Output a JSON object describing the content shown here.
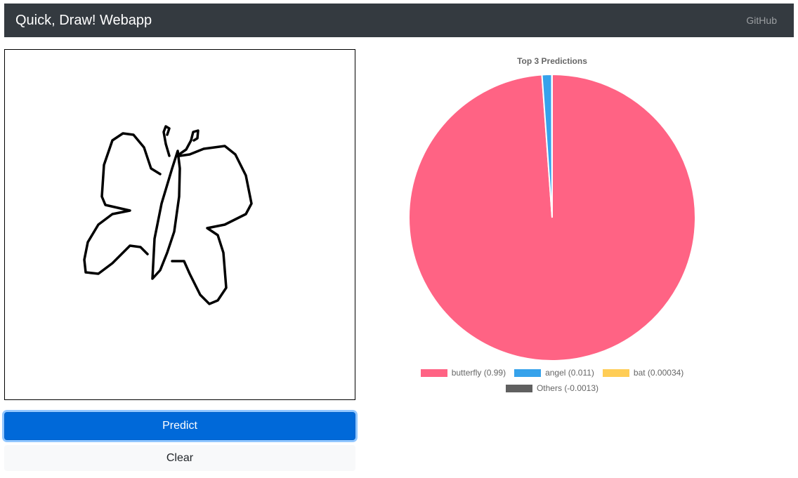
{
  "navbar": {
    "brand": "Quick, Draw! Webapp",
    "github_link": "GitHub"
  },
  "buttons": {
    "predict": "Predict",
    "clear": "Clear"
  },
  "chart_data": {
    "type": "pie",
    "title": "Top 3 Predictions",
    "legend_position": "bottom",
    "series": [
      {
        "label": "butterfly (0.99)",
        "value": 0.99,
        "color": "#ff6384"
      },
      {
        "label": "angel (0.011)",
        "value": 0.011,
        "color": "#36a2eb"
      },
      {
        "label": "bat (0.00034)",
        "value": 0.00034,
        "color": "#ffcd56"
      },
      {
        "label": "Others (-0.0013)",
        "value": -0.0013,
        "color": "#606060"
      }
    ]
  }
}
